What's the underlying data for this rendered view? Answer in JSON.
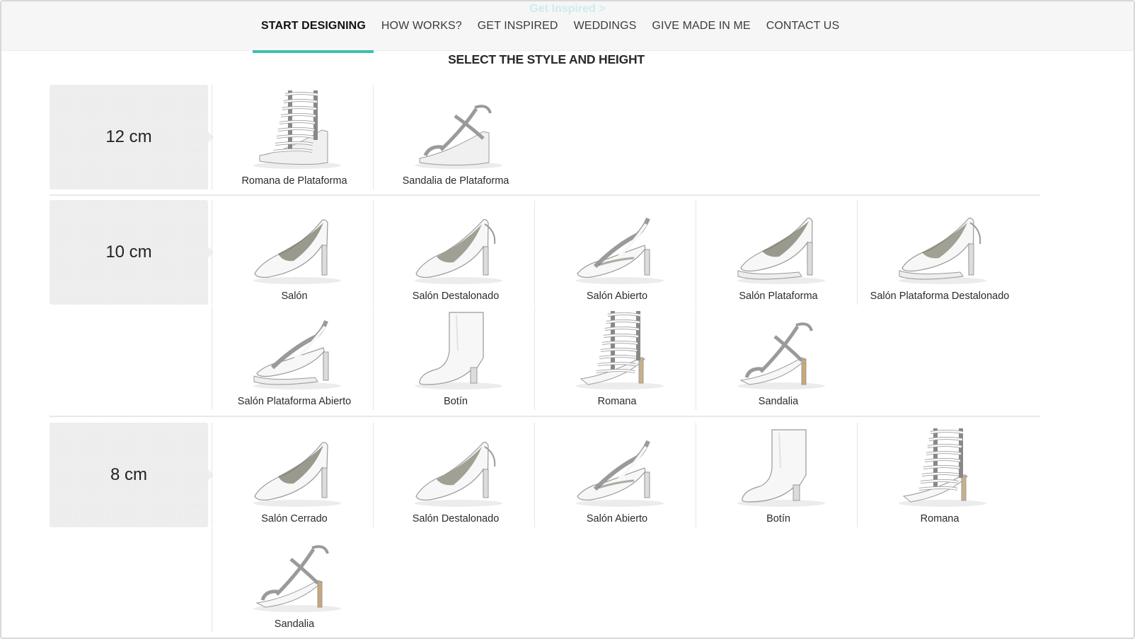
{
  "header": {
    "ghost_link": "Get Inspired >",
    "nav": [
      {
        "label": "START DESIGNING",
        "active": true
      },
      {
        "label": "HOW WORKS?"
      },
      {
        "label": "GET INSPIRED"
      },
      {
        "label": "WEDDINGS"
      },
      {
        "label": "GIVE MADE IN ME"
      },
      {
        "label": "CONTACT US"
      }
    ],
    "accent_color": "#3dbfb0"
  },
  "page": {
    "subtitle": "SELECT THE STYLE AND HEIGHT"
  },
  "sections": [
    {
      "height": "12 cm",
      "shoes": [
        {
          "label": "Romana de Plataforma",
          "icon": "gladiator-platform-shoe-icon"
        },
        {
          "label": "Sandalia de Plataforma",
          "icon": "platform-sandal-icon"
        }
      ]
    },
    {
      "height": "10 cm",
      "shoes": [
        {
          "label": "Salón",
          "icon": "pump-shoe-icon"
        },
        {
          "label": "Salón Destalonado",
          "icon": "slingback-shoe-icon"
        },
        {
          "label": "Salón Abierto",
          "icon": "open-pump-shoe-icon"
        },
        {
          "label": "Salón Plataforma",
          "icon": "platform-pump-shoe-icon"
        },
        {
          "label": "Salón Plataforma Destalonado",
          "icon": "platform-slingback-shoe-icon"
        },
        {
          "label": "Salón Plataforma Abierto",
          "icon": "open-platform-pump-shoe-icon"
        },
        {
          "label": "Botín",
          "icon": "ankle-boot-icon"
        },
        {
          "label": "Romana",
          "icon": "gladiator-sandal-icon"
        },
        {
          "label": "Sandalia",
          "icon": "strappy-sandal-icon"
        }
      ]
    },
    {
      "height": "8 cm",
      "shoes": [
        {
          "label": "Salón Cerrado",
          "icon": "pump-shoe-icon"
        },
        {
          "label": "Salón Destalonado",
          "icon": "slingback-shoe-icon"
        },
        {
          "label": "Salón Abierto",
          "icon": "open-pump-shoe-icon"
        },
        {
          "label": "Botín",
          "icon": "ankle-boot-icon"
        },
        {
          "label": "Romana",
          "icon": "gladiator-sandal-icon"
        },
        {
          "label": "Sandalia",
          "icon": "strappy-sandal-icon"
        }
      ]
    }
  ]
}
